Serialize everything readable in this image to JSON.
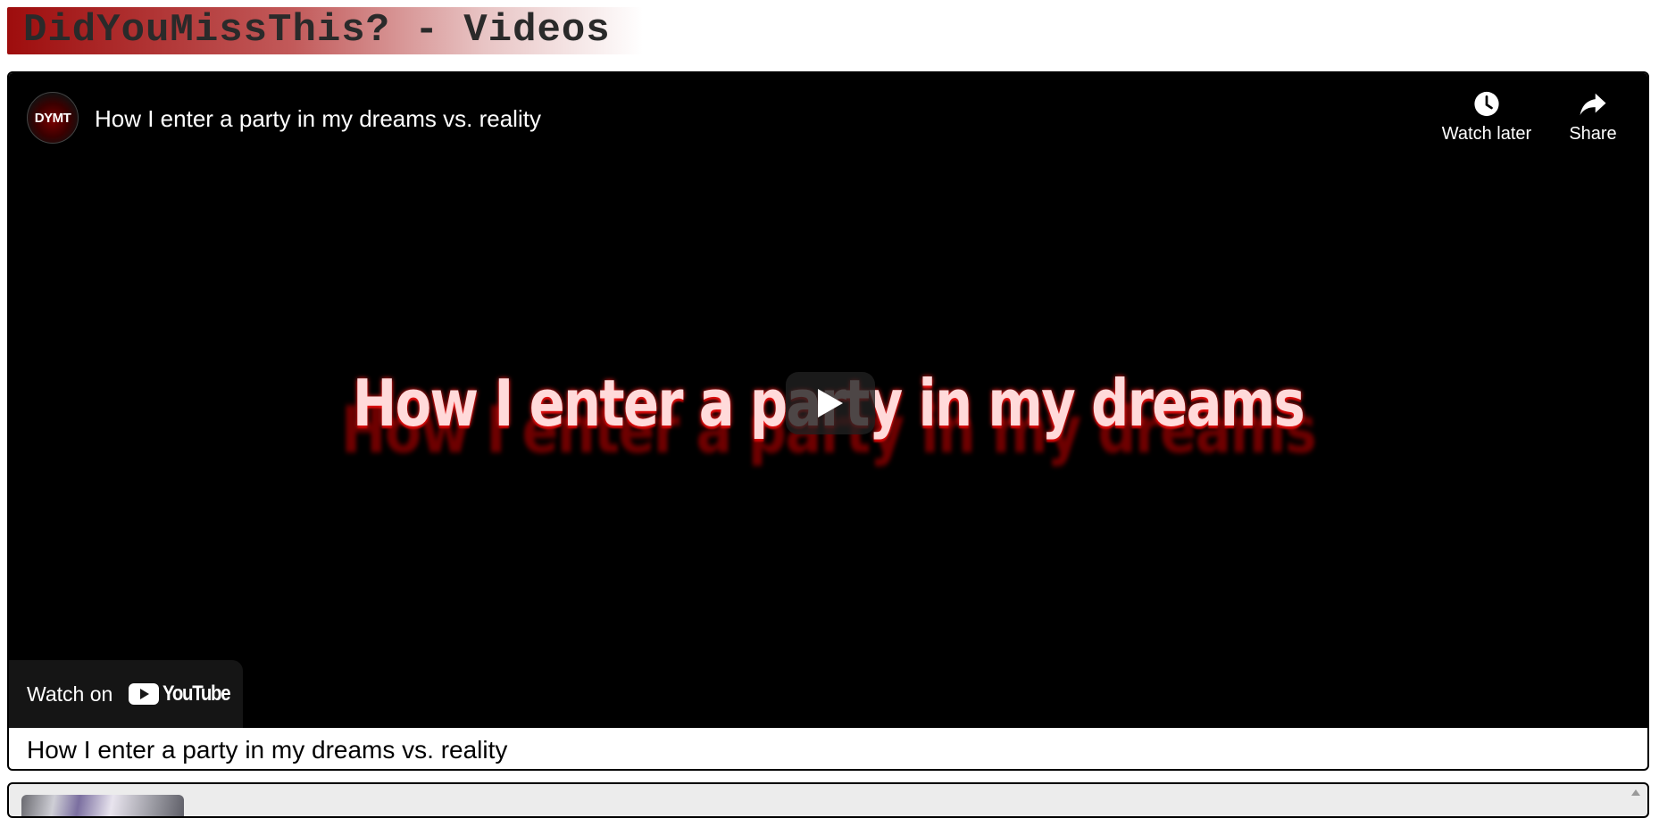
{
  "site": {
    "title": "DidYouMissThis? - Videos"
  },
  "player": {
    "channel_avatar_text": "DYMT",
    "title": "How I enter a party in my dreams vs. reality",
    "frame_text": "How I enter a party in my dreams",
    "watch_later_label": "Watch later",
    "watch_later_icon": "clock-icon",
    "share_label": "Share",
    "share_icon": "share-arrow-icon",
    "play_icon": "play-icon",
    "watch_on_label": "Watch on",
    "youtube_wordmark": "YouTube",
    "colors": {
      "frame_text": "#ffdada",
      "frame_glow": "#ff2020",
      "youtube_red": "#ff0000"
    }
  },
  "video": {
    "caption": "How I enter a party in my dreams vs. reality"
  },
  "colors": {
    "header_gradient_start": "#9e0d0d",
    "header_gradient_end": "#ffffff",
    "card_border": "#000000",
    "next_card_bg": "#ececec"
  }
}
